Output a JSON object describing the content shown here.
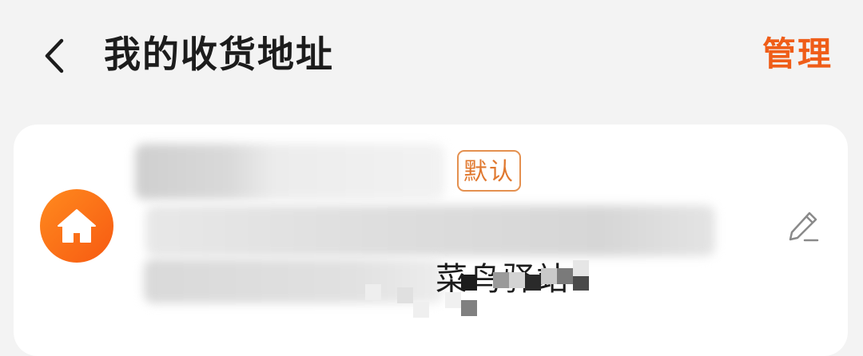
{
  "header": {
    "back_icon": "chevron-left-icon",
    "title": "我的收货地址",
    "manage_label": "管理"
  },
  "address_card": {
    "avatar_icon": "home-icon",
    "default_badge": "默认",
    "address_partial": "菜鸟驿站",
    "edit_icon": "edit-pencil-icon"
  },
  "colors": {
    "accent": "#ef5d18",
    "background": "#f3f3f3",
    "card": "#ffffff"
  }
}
